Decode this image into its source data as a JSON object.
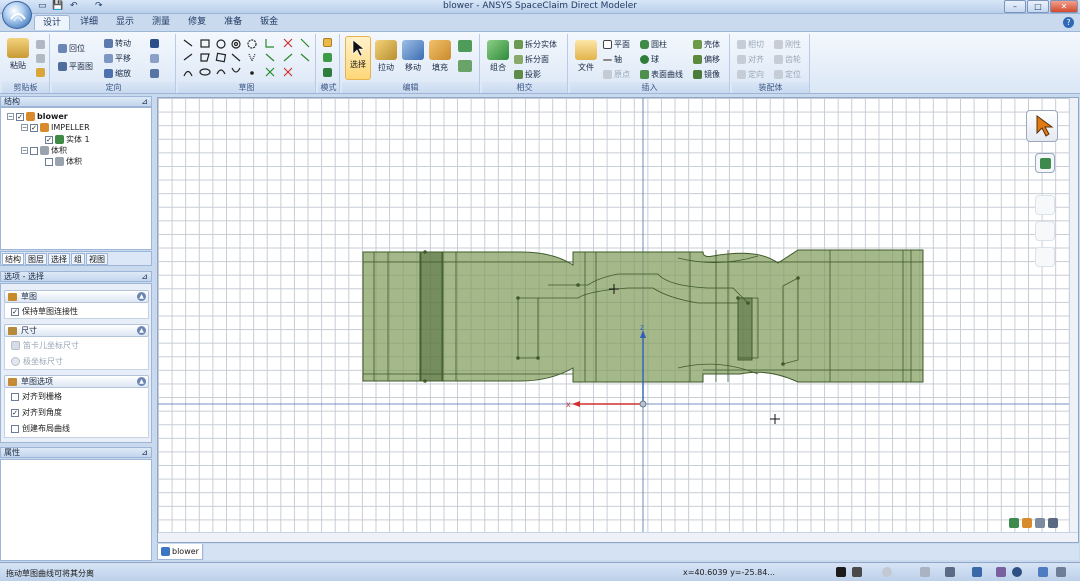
{
  "window": {
    "title": "blower - ANSYS SpaceClaim Direct Modeler",
    "minimize": "–",
    "maximize": "□",
    "close": "✕"
  },
  "quick_access": [
    "▭",
    "💾",
    "↶",
    "↷"
  ],
  "ribbon_tabs": [
    "设计",
    "详细",
    "显示",
    "测量",
    "修复",
    "准备",
    "钣金"
  ],
  "active_tab": "设计",
  "help_label": "?",
  "ribbon": {
    "clipboard": {
      "label": "剪贴板",
      "paste": "粘贴"
    },
    "orient": {
      "label": "定向",
      "home": "回位",
      "plan": "平面图",
      "spin": "转动",
      "pan": "平移",
      "zoom": "缩放"
    },
    "sketch": {
      "label": "草图"
    },
    "mode": {
      "label": "模式"
    },
    "edit": {
      "label": "编辑",
      "select": "选择",
      "pull": "拉动",
      "move": "移动",
      "fill": "填充"
    },
    "intersect": {
      "label": "相交",
      "combine": "组合",
      "split_body": "拆分实体",
      "split_face": "拆分面",
      "project": "投影"
    },
    "insert": {
      "label": "插入",
      "file": "文件",
      "plane": "平面",
      "axis": "轴",
      "origin": "原点",
      "cylinder": "圆柱",
      "sphere": "球",
      "surface_curve": "表面曲线",
      "shell": "壳体",
      "offset": "偏移",
      "mirror": "镜像"
    },
    "assembly": {
      "label": "装配体",
      "tangent": "相切",
      "align": "对齐",
      "orient": "定向",
      "rigid": "刚性",
      "gear": "齿轮",
      "anchor": "定位"
    }
  },
  "structure_panel": {
    "title": "结构",
    "pin": "⊿",
    "tree": [
      {
        "label": "blower",
        "checked": true,
        "level": 0
      },
      {
        "label": "IMPELLER",
        "checked": true,
        "level": 1
      },
      {
        "label": "实体 1",
        "checked": true,
        "level": 2
      },
      {
        "label": "体积",
        "checked": false,
        "level": 1
      },
      {
        "label": "体积",
        "checked": false,
        "level": 2
      }
    ]
  },
  "panel_tabs": [
    "结构",
    "图层",
    "选择",
    "组",
    "视图"
  ],
  "options_panel": {
    "title": "选项 - 选择",
    "sections": [
      {
        "title": "草图",
        "options": [
          {
            "label": "保持草图连接性",
            "checked": true,
            "kind": "checkbox",
            "disabled": false
          }
        ]
      },
      {
        "title": "尺寸",
        "options": [
          {
            "label": "笛卡儿坐标尺寸",
            "checked": false,
            "kind": "checkbox",
            "disabled": true
          },
          {
            "label": "极坐标尺寸",
            "checked": false,
            "kind": "radio",
            "disabled": true
          }
        ]
      },
      {
        "title": "草图选项",
        "options": [
          {
            "label": "对齐到栅格",
            "checked": false,
            "kind": "checkbox",
            "disabled": false
          },
          {
            "label": "对齐到角度",
            "checked": true,
            "kind": "checkbox",
            "disabled": false
          },
          {
            "label": "创建布局曲线",
            "checked": false,
            "kind": "checkbox",
            "disabled": false
          }
        ]
      }
    ]
  },
  "properties_panel": {
    "title": "属性"
  },
  "viewport": {
    "axis_x_label": "x",
    "axis_z_label": "z",
    "model_color": "#7f9a58",
    "model_stroke": "#3e5a2a"
  },
  "document_tab": "blower",
  "status": {
    "message": "拖动草图曲线可将其分离",
    "coords": "x=40.6039  y=-25.84..."
  }
}
